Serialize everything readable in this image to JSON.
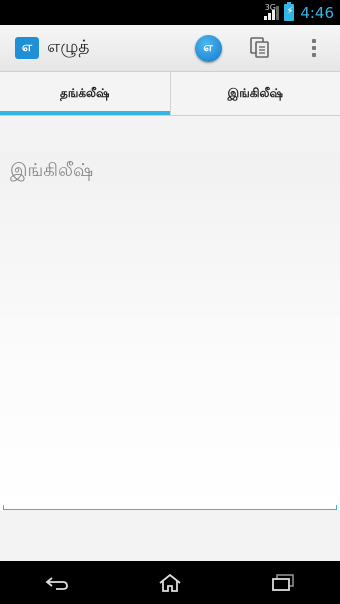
{
  "status_bar": {
    "network": "3G",
    "time": "4:46"
  },
  "action_bar": {
    "app_icon_letter": "எ",
    "title": "எழுத்",
    "transliterate_button_letter": "எ",
    "icons": [
      "app-logo-icon",
      "transliterate-icon",
      "copy-icon",
      "overflow-menu-icon"
    ]
  },
  "tabs": [
    {
      "label": "தங்க்லீஷ்",
      "active": true
    },
    {
      "label": "இங்கிலீஷ்",
      "active": false
    }
  ],
  "editor": {
    "value": "",
    "placeholder": "இங்கிலீஷ்"
  },
  "nav_bar": {
    "icons": [
      "back-icon",
      "home-icon",
      "recent-apps-icon"
    ]
  },
  "colors": {
    "accent": "#33b5e5",
    "app_icon": "#1f8fd6"
  }
}
